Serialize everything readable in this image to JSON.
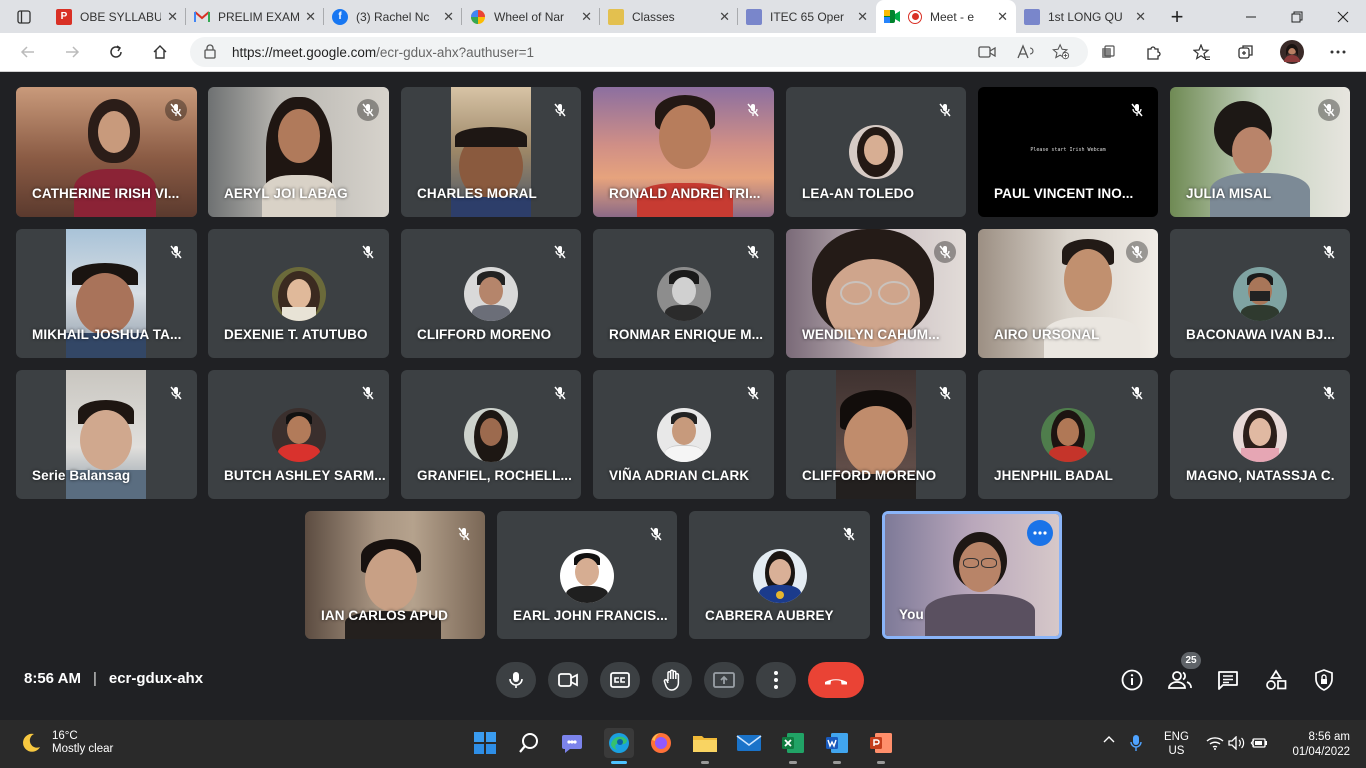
{
  "browser": {
    "tabs": [
      {
        "title": "OBE SYLLABU",
        "icon": "pdf-icon",
        "color": "#d93025",
        "active": false
      },
      {
        "title": "PRELIM EXAM",
        "icon": "gmail-icon",
        "color": "#d93025",
        "active": false
      },
      {
        "title": "(3) Rachel Nc",
        "icon": "facebook-icon",
        "color": "#1877f2",
        "active": false
      },
      {
        "title": "Wheel of Nar",
        "icon": "wheel-icon",
        "color": "#e8710a",
        "active": false
      },
      {
        "title": "Classes",
        "icon": "classroom-icon",
        "color": "#c8a800",
        "active": false
      },
      {
        "title": "ITEC 65 Oper",
        "icon": "form-icon",
        "color": "#5c6bc0",
        "active": false
      },
      {
        "title": "Meet - e",
        "icon": "meet-icon",
        "color": "#00832d",
        "active": true
      },
      {
        "title": "1st LONG QU",
        "icon": "form-icon",
        "color": "#5c6bc0",
        "active": false
      }
    ],
    "close_glyph": "✕",
    "new_tab_glyph": "+",
    "url_host": "https://meet.google.com",
    "url_rest": "/ecr-gdux-ahx?authuser=1"
  },
  "participants": [
    {
      "name": "CATHERINE IRISH VI..."
    },
    {
      "name": "AERYL JOI LABAG"
    },
    {
      "name": "CHARLES MORAL"
    },
    {
      "name": "RONALD ANDREI TRI..."
    },
    {
      "name": "LEA-AN TOLEDO"
    },
    {
      "name": "PAUL VINCENT INO...",
      "screen_text": "Please start Irish Webcam"
    },
    {
      "name": "JULIA MISAL"
    },
    {
      "name": "MIKHAIL JOSHUA TA..."
    },
    {
      "name": "DEXENIE T. ATUTUBO"
    },
    {
      "name": "CLIFFORD MORENO"
    },
    {
      "name": "RONMAR ENRIQUE M..."
    },
    {
      "name": "WENDILYN CAHUM..."
    },
    {
      "name": "AIRO URSONAL"
    },
    {
      "name": "BACONAWA IVAN BJ..."
    },
    {
      "name": "Serie Balansag"
    },
    {
      "name": "BUTCH ASHLEY SARM..."
    },
    {
      "name": "GRANFIEL, ROCHELL..."
    },
    {
      "name": "VIÑA ADRIAN CLARK"
    },
    {
      "name": "CLIFFORD MORENO"
    },
    {
      "name": "JHENPHIL BADAL"
    },
    {
      "name": "MAGNO, NATASSJA C."
    },
    {
      "name": "IAN CARLOS APUD"
    },
    {
      "name": "EARL JOHN FRANCIS..."
    },
    {
      "name": "CABRERA AUBREY"
    },
    {
      "name": "You"
    }
  ],
  "meeting": {
    "time": "8:56 AM",
    "separator": "|",
    "code": "ecr-gdux-ahx",
    "people_count": "25"
  },
  "taskbar": {
    "temp": "16°C",
    "condition": "Mostly clear",
    "lang1": "ENG",
    "lang2": "US",
    "time": "8:56 am",
    "date": "01/04/2022"
  }
}
